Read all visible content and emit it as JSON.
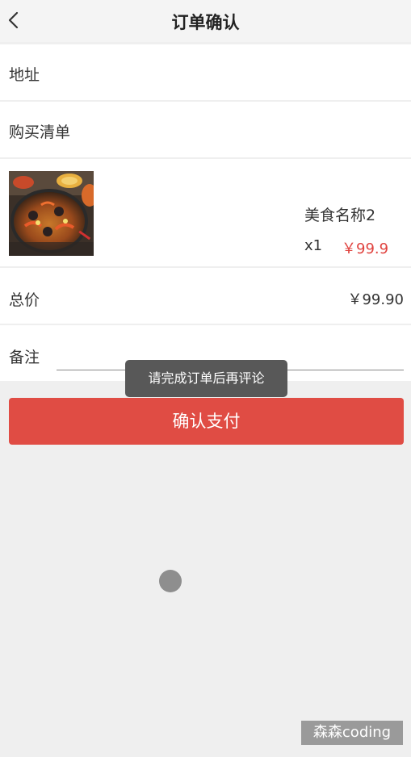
{
  "header": {
    "title": "订单确认",
    "back_icon": "chevron-left-icon"
  },
  "address": {
    "label": "地址"
  },
  "order_list": {
    "label": "购买清单",
    "items": [
      {
        "name": "美食名称2",
        "quantity": "x1",
        "price": "￥99.9",
        "image": "seafood-paella-photo"
      }
    ]
  },
  "total": {
    "label": "总价",
    "value": "￥99.90"
  },
  "remark": {
    "label": "备注",
    "value": ""
  },
  "pay_button": {
    "label": "确认支付"
  },
  "toast": {
    "message": "请完成订单后再评论"
  },
  "watermark": {
    "text": "森森coding"
  },
  "colors": {
    "accent": "#e04c44",
    "price": "#e0433f",
    "background": "#efefef"
  }
}
